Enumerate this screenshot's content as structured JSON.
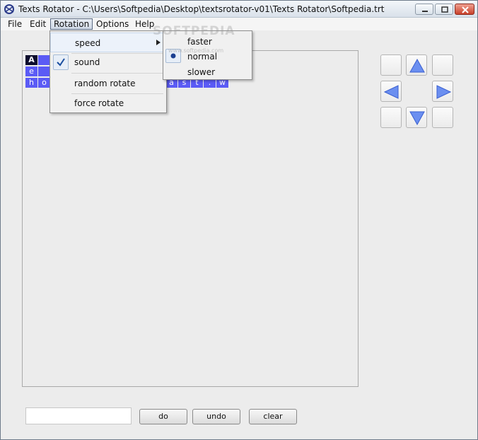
{
  "window": {
    "title": "Texts Rotator - C:\\Users\\Softpedia\\Desktop\\textsrotator-v01\\Texts Rotator\\Softpedia.trt",
    "icon": "app-icon"
  },
  "menubar": {
    "file": "File",
    "edit": "Edit",
    "rotation": "Rotation",
    "options": "Options",
    "help": "Help"
  },
  "rotation_menu": {
    "items": [
      {
        "label": "speed",
        "has_submenu": true,
        "highlighted": true
      },
      {
        "label": "sound",
        "checked": true
      },
      {
        "label": "random rotate"
      },
      {
        "label": "force rotate"
      }
    ]
  },
  "speed_submenu": {
    "items": [
      {
        "label": "faster"
      },
      {
        "label": "normal",
        "selected": true
      },
      {
        "label": "slower"
      }
    ]
  },
  "grid": {
    "rows": [
      [
        "A",
        "",
        "",
        ""
      ],
      [
        "e",
        "",
        "",
        ""
      ],
      [
        "h",
        "o",
        "",
        "",
        "",
        "",
        "",
        "",
        "",
        "",
        "",
        "a",
        "s",
        "t",
        ".",
        "w"
      ]
    ]
  },
  "watermark": {
    "text": "SOFTPEDIA",
    "sub": "www.softpedia.com"
  },
  "controls": {
    "input_value": "",
    "do": "do",
    "undo": "undo",
    "clear": "clear"
  },
  "colors": {
    "cell": "#5b5bf5",
    "cell_selected": "#0c0c2c",
    "arrow": "#6b8ff0"
  }
}
